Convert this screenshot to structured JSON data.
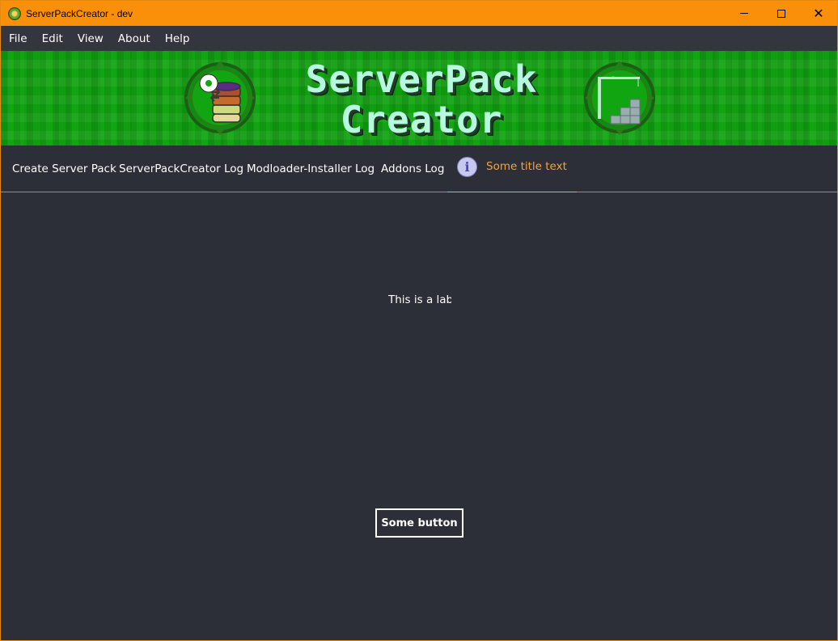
{
  "window": {
    "title": "ServerPackCreator - dev",
    "title_bar_color": "#fa9009",
    "icons": {
      "app": "app-logo-icon",
      "minimize": "minimize-icon",
      "maximize": "maximize-icon",
      "close": "close-icon"
    },
    "close_glyph": "✕"
  },
  "menu": {
    "items": [
      "File",
      "Edit",
      "View",
      "About",
      "Help"
    ]
  },
  "banner": {
    "title_line1": "ServerPack",
    "title_line2": "Creator",
    "background_color": "#12a512",
    "text_color": "#b8f7e0"
  },
  "tabs": [
    {
      "label": "Create Server Pack",
      "active": false
    },
    {
      "label": "ServerPackCreator Log",
      "active": false
    },
    {
      "label": "Modloader-Installer Log",
      "active": false
    },
    {
      "label": "Addons Log",
      "active": false
    },
    {
      "label": "Some title text",
      "active": true,
      "icon": "info-icon",
      "icon_glyph": "i"
    }
  ],
  "content": {
    "label": "This is a label",
    "button_label": "Some button"
  },
  "colors": {
    "background": "#2d2f38",
    "menubar": "#33353f",
    "active_tab": "#f4a240",
    "text": "#ffffff"
  }
}
